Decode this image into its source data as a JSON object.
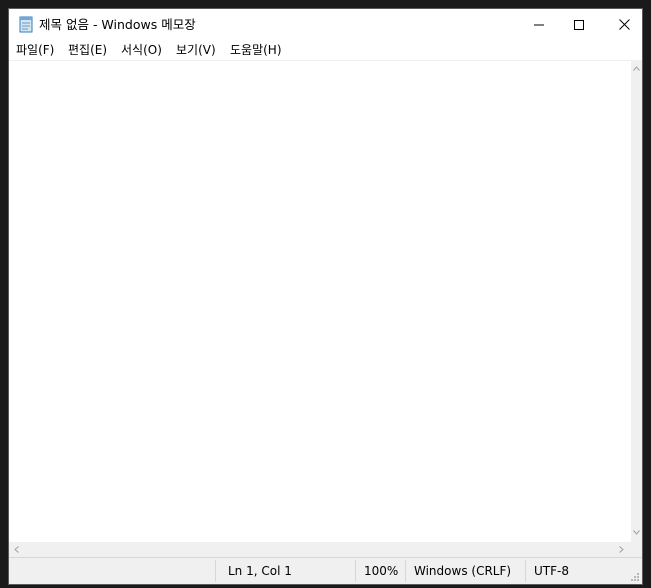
{
  "window": {
    "title": "제목 없음 - Windows 메모장"
  },
  "menu": {
    "items": [
      {
        "label": "파일(F)"
      },
      {
        "label": "편집(E)"
      },
      {
        "label": "서식(O)"
      },
      {
        "label": "보기(V)"
      },
      {
        "label": "도움말(H)"
      }
    ]
  },
  "editor": {
    "content": ""
  },
  "status": {
    "position": "Ln 1, Col 1",
    "zoom": "100%",
    "line_ending": "Windows (CRLF)",
    "encoding": "UTF-8"
  },
  "icons": {
    "app": "notepad-icon",
    "minimize": "minimize-icon",
    "maximize": "maximize-icon",
    "close": "close-icon"
  },
  "colors": {
    "background": "#ffffff",
    "chrome": "#f0f0f0",
    "text": "#000000"
  }
}
